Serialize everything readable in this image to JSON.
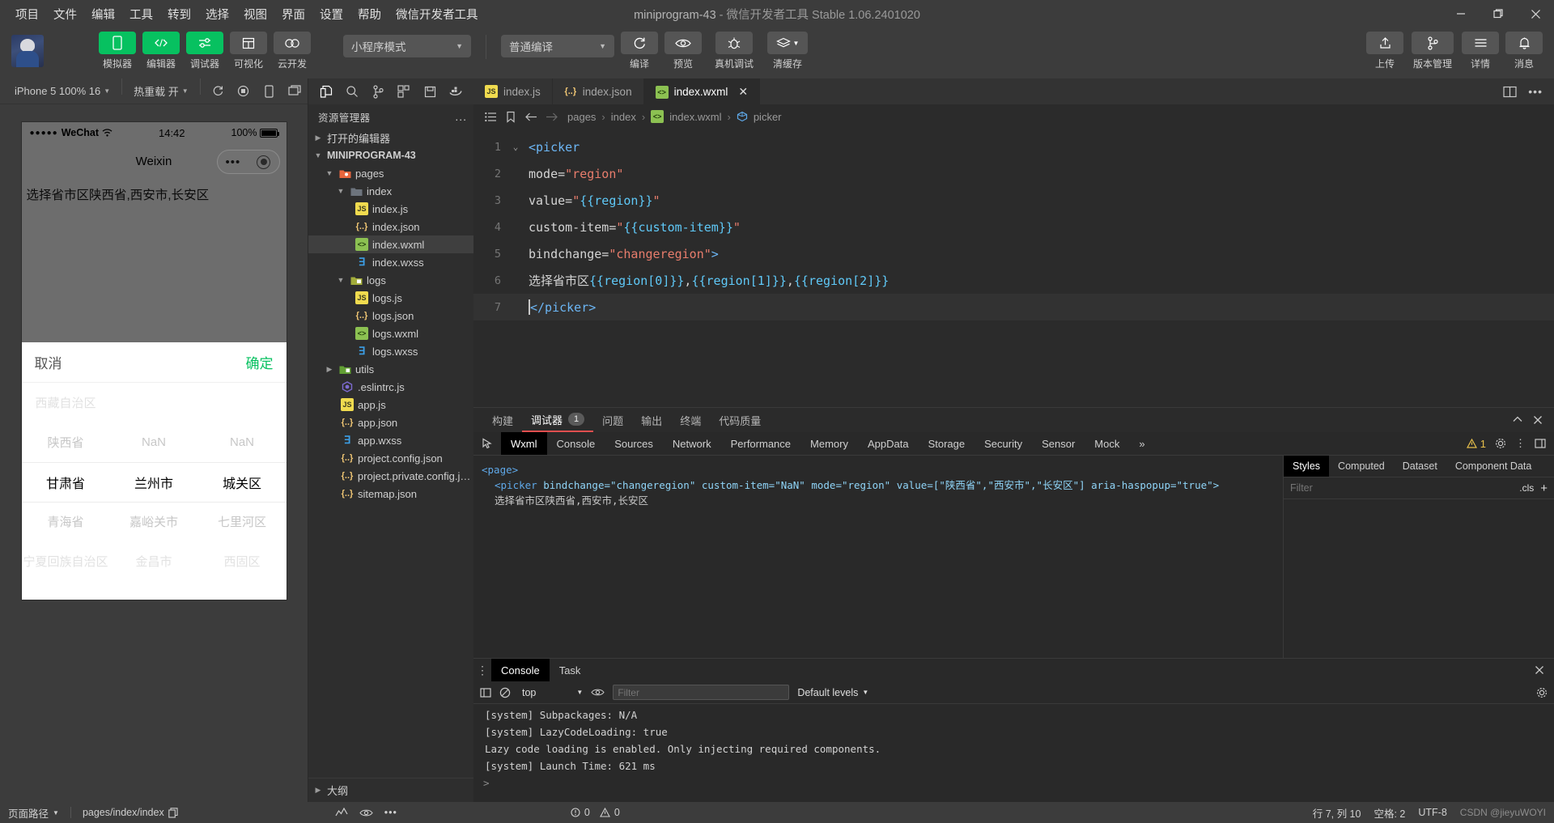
{
  "titlebar": {
    "menus": [
      "项目",
      "文件",
      "编辑",
      "工具",
      "转到",
      "选择",
      "视图",
      "界面",
      "设置",
      "帮助",
      "微信开发者工具"
    ],
    "project_name": "miniprogram-43",
    "dash": " - ",
    "app_version": "微信开发者工具 Stable 1.06.2401020",
    "minimize": "−",
    "maximize": "❐",
    "close": "✕"
  },
  "toolbar": {
    "buttons": [
      {
        "label": "模拟器",
        "icon": "phone-icon",
        "style": "green"
      },
      {
        "label": "编辑器",
        "icon": "code-icon",
        "style": "green"
      },
      {
        "label": "调试器",
        "icon": "sliders-icon",
        "style": "green"
      },
      {
        "label": "可视化",
        "icon": "layout-icon",
        "style": "grey"
      },
      {
        "label": "云开发",
        "icon": "cloud-icon",
        "style": "grey"
      }
    ],
    "mode_select": "小程序模式",
    "compile_select": "普通编译",
    "actions": [
      {
        "label": "编译",
        "icon": "refresh-icon"
      },
      {
        "label": "预览",
        "icon": "eye-icon"
      },
      {
        "label": "真机调试",
        "icon": "bug-icon"
      },
      {
        "label": "清缓存",
        "icon": "layers-icon"
      }
    ],
    "right_actions": [
      {
        "label": "上传",
        "icon": "upload-icon"
      },
      {
        "label": "版本管理",
        "icon": "branch-icon"
      },
      {
        "label": "详情",
        "icon": "menu-icon"
      },
      {
        "label": "消息",
        "icon": "bell-icon"
      }
    ]
  },
  "simulator": {
    "device": "iPhone 5 100% 16",
    "hot_reload": "热重载 开",
    "icons": [
      "refresh-icon",
      "record-icon",
      "rotate-icon",
      "window-icon"
    ],
    "phone": {
      "carrier": "WeChat",
      "dots": "●●●●●",
      "time": "14:42",
      "battery": "100%",
      "nav_title": "Weixin",
      "page_text": "选择省市区陕西省,西安市,长安区"
    },
    "picker": {
      "cancel": "取消",
      "confirm": "确定",
      "columns": [
        {
          "items": [
            "西藏自治区",
            "陕西省",
            "甘肃省",
            "青海省",
            "宁夏回族自治区"
          ],
          "selected_index": 2
        },
        {
          "items": [
            "",
            "NaN",
            "兰州市",
            "嘉峪关市",
            "金昌市"
          ],
          "selected_index": 2
        },
        {
          "items": [
            "",
            "NaN",
            "城关区",
            "七里河区",
            "西固区"
          ],
          "selected_index": 2
        }
      ]
    }
  },
  "explorer": {
    "title": "资源管理器",
    "icons": [
      "files-icon",
      "search-icon",
      "branch-icon",
      "extensions-icon",
      "save-icon",
      "docker-icon"
    ],
    "more": "...",
    "open_editors": "打开的编辑器",
    "project_root": "MINIPROGRAM-43",
    "outline": "大纲",
    "tree": [
      {
        "name": "pages",
        "type": "folder-pages",
        "depth": 1,
        "expanded": true
      },
      {
        "name": "index",
        "type": "folder",
        "depth": 2,
        "expanded": true
      },
      {
        "name": "index.js",
        "type": "js",
        "depth": 3
      },
      {
        "name": "index.json",
        "type": "json",
        "depth": 3
      },
      {
        "name": "index.wxml",
        "type": "wxml",
        "depth": 3,
        "selected": true
      },
      {
        "name": "index.wxss",
        "type": "wxss",
        "depth": 3
      },
      {
        "name": "logs",
        "type": "folder-logs",
        "depth": 2,
        "expanded": true
      },
      {
        "name": "logs.js",
        "type": "js",
        "depth": 3
      },
      {
        "name": "logs.json",
        "type": "json",
        "depth": 3
      },
      {
        "name": "logs.wxml",
        "type": "wxml",
        "depth": 3
      },
      {
        "name": "logs.wxss",
        "type": "wxss",
        "depth": 3
      },
      {
        "name": "utils",
        "type": "folder-utils",
        "depth": 1,
        "expanded": false
      },
      {
        "name": ".eslintrc.js",
        "type": "eslint",
        "depth": 1
      },
      {
        "name": "app.js",
        "type": "js",
        "depth": 1
      },
      {
        "name": "app.json",
        "type": "json",
        "depth": 1
      },
      {
        "name": "app.wxss",
        "type": "wxss",
        "depth": 1
      },
      {
        "name": "project.config.json",
        "type": "json",
        "depth": 1
      },
      {
        "name": "project.private.config.js...",
        "type": "json",
        "depth": 1
      },
      {
        "name": "sitemap.json",
        "type": "json",
        "depth": 1
      }
    ]
  },
  "editor": {
    "tabs": [
      {
        "label": "index.js",
        "icon": "js",
        "active": false
      },
      {
        "label": "index.json",
        "icon": "json",
        "active": false
      },
      {
        "label": "index.wxml",
        "icon": "wxml",
        "active": true,
        "close": "✕"
      }
    ],
    "breadcrumb": [
      "pages",
      "index",
      "index.wxml",
      "picker"
    ],
    "code_lines": [
      {
        "n": "1",
        "fold": "⌄",
        "html": "<span class='tok-tag'>&lt;picker</span>"
      },
      {
        "n": "2",
        "fold": "",
        "html": "<span class='tok-attr'>mode=</span><span class='tok-str'>\"region\"</span>"
      },
      {
        "n": "3",
        "fold": "",
        "html": "<span class='tok-attr'>value=</span><span class='tok-str'>\"</span><span class='tok-brace'>{{region}}</span><span class='tok-str'>\"</span>"
      },
      {
        "n": "4",
        "fold": "",
        "html": "<span class='tok-attr'>custom-item=</span><span class='tok-str'>\"</span><span class='tok-brace'>{{custom-item}}</span><span class='tok-str'>\"</span>"
      },
      {
        "n": "5",
        "fold": "",
        "html": "<span class='tok-attr'>bindchange=</span><span class='tok-str'>\"changeregion\"</span><span class='tok-tag'>&gt;</span>"
      },
      {
        "n": "6",
        "fold": "",
        "html": "<span class='tok-txt'>选择省市区</span><span class='tok-brace'>{{region[0]}}</span><span class='tok-txt'>,</span><span class='tok-brace'>{{region[1]}}</span><span class='tok-txt'>,</span><span class='tok-brace'>{{region[2]}}</span>"
      },
      {
        "n": "7",
        "fold": "",
        "cur": true,
        "html": "<span class='cursor-blk'></span><span class='tok-tag'>&lt;/picker&gt;</span>"
      }
    ]
  },
  "devtools": {
    "top_tabs": [
      {
        "label": "构建",
        "active": false
      },
      {
        "label": "调试器",
        "active": true,
        "badge": "1"
      },
      {
        "label": "问题",
        "active": false
      },
      {
        "label": "输出",
        "active": false
      },
      {
        "label": "终端",
        "active": false
      },
      {
        "label": "代码质量",
        "active": false
      }
    ],
    "panel_tabs": [
      "Wxml",
      "Console",
      "Sources",
      "Network",
      "Performance",
      "Memory",
      "AppData",
      "Storage",
      "Security",
      "Sensor",
      "Mock"
    ],
    "active_panel": "Wxml",
    "overflow": "»",
    "warn_count": "1",
    "wxml": {
      "line1": "<page>",
      "line2_tag": "<picker ",
      "attrs": "bindchange=\"changeregion\" custom-item=\"NaN\" mode=\"region\" value=[\"陕西省\",\"西安市\",\"长安区\"] aria-haspopup=\"true\">",
      "line3": "选择省市区陕西省,西安市,长安区"
    },
    "styles_tabs": [
      "Styles",
      "Computed",
      "Dataset",
      "Component Data"
    ],
    "active_styles_tab": "Styles",
    "filter_placeholder": "Filter",
    "cls_label": ".cls",
    "plus_label": "+"
  },
  "console": {
    "tabs": [
      "Console",
      "Task"
    ],
    "active_tab": "Console",
    "context": "top",
    "filter_placeholder": "Filter",
    "levels": "Default levels",
    "close": "✕",
    "logs": [
      "[system] Subpackages: N/A",
      "[system] LazyCodeLoading: true",
      "Lazy code loading is enabled. Only injecting required components.",
      "[system] Launch Time: 621 ms"
    ],
    "prompt": ">"
  },
  "statusbar": {
    "route_label": "页面路径",
    "route_value": "pages/index/index",
    "errors": "0",
    "warnings": "0",
    "position": "行 7, 列 10",
    "spaces": "空格: 2",
    "encoding": "UTF-8",
    "watermark": "CSDN @jieyuWOYI"
  }
}
